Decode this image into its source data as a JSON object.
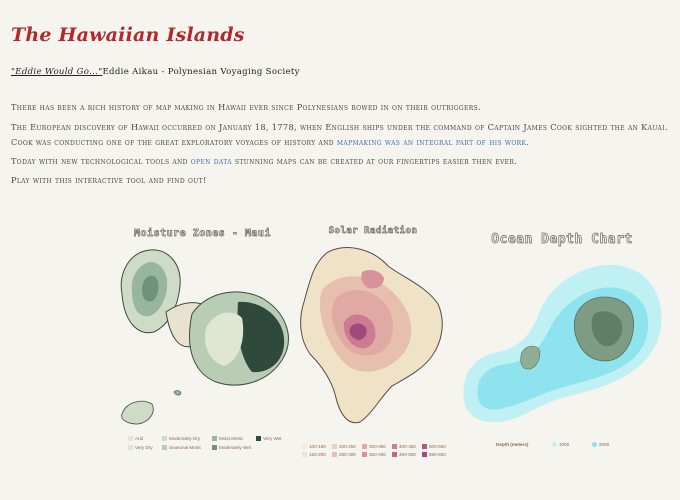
{
  "page": {
    "title": "The Hawaiian Islands",
    "quote_link": "\"Eddie Would Go...\"",
    "quote_rest": "Eddie Aikau - Polynesian Voyaging Society",
    "para1": "There has been a rich history of map making in Hawaii ever since Polynesians rowed in on their outriggers.",
    "para2_a": "The European discovery of Hawaii occurred on January 18, 1778, when English ships under the command of Captain James Cook sighted the an Kauai. Cook was conducting one of the great exploratory voyages of history and ",
    "para2_link": "mapmaking was an integral part of his work",
    "para2_b": ".",
    "para3_a": "Today with new technological tools and ",
    "para3_link": "open data",
    "para3_b": " stunning maps can be created at our fingertips easier then ever.",
    "para4": "Play with this interactive tool and find out!"
  },
  "maps": {
    "moisture": {
      "title": "Moisture Zones - Maui",
      "legend": [
        "Arid",
        "Very Dry",
        "Moderately Dry",
        "Seasonal Mesic",
        "Moist Mesic",
        "Moderately Wet",
        "Very Wet"
      ],
      "colors": [
        "#e8e2cf",
        "#dfe6d2",
        "#cfdcc5",
        "#b9cdb5",
        "#98b59d",
        "#6f927c",
        "#2f4a3c"
      ]
    },
    "solar": {
      "title": "Solar Radiation",
      "legend": [
        "100-150",
        "150-200",
        "200-250",
        "250-300",
        "300-350",
        "350-400",
        "400-450",
        "450-500",
        "500-550",
        "550-600"
      ],
      "colors": [
        "#f3ecd6",
        "#f0e2c6",
        "#ecd2b8",
        "#e7bfae",
        "#e1a9a4",
        "#d8929b",
        "#cc7b92",
        "#bf6789",
        "#b05882",
        "#9e4a7a"
      ]
    },
    "ocean": {
      "title": "Ocean Depth Chart",
      "legend_label": "Depth (meters)",
      "legend": [
        "1000",
        "2000"
      ],
      "colors": [
        "#bff0f4",
        "#8ee3ee"
      ]
    }
  }
}
